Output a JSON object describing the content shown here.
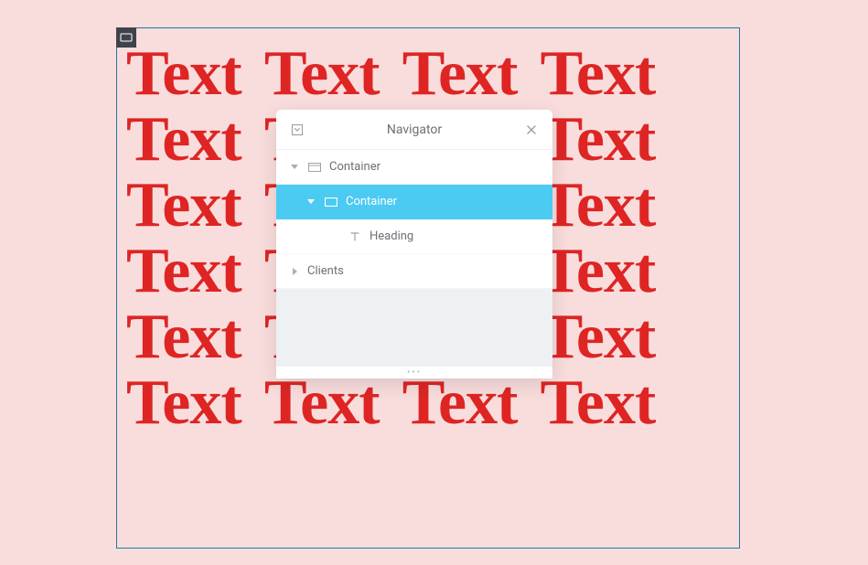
{
  "background_text_word": "Text",
  "background_text_repeat": 24,
  "navigator": {
    "title": "Navigator",
    "tree": {
      "item0": {
        "label": "Container"
      },
      "item1": {
        "label": "Container"
      },
      "item2": {
        "label": "Heading"
      },
      "item3": {
        "label": "Clients"
      }
    }
  }
}
